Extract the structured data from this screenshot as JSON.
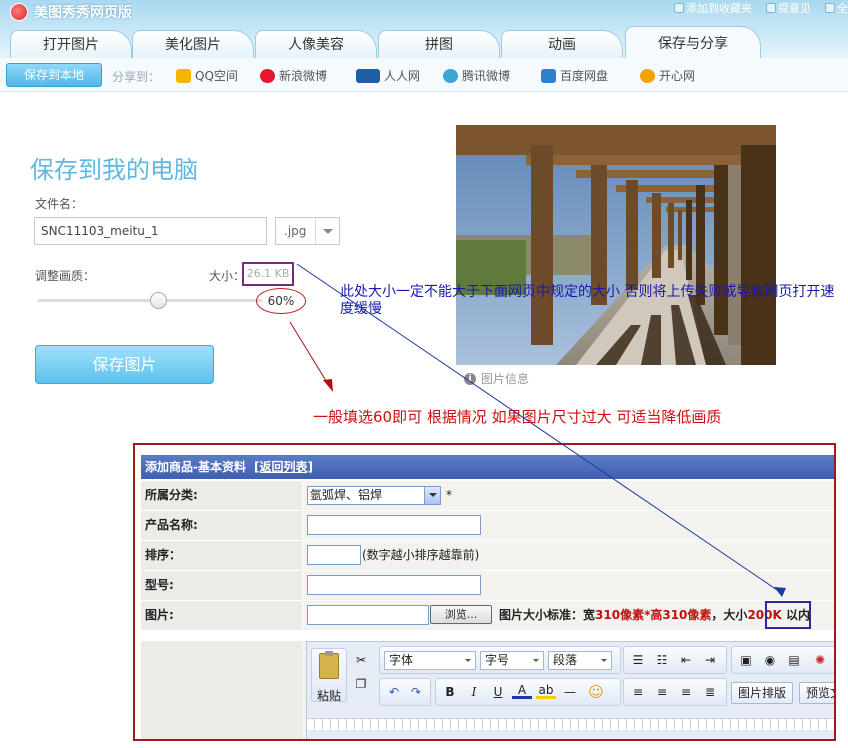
{
  "app": {
    "title": "美图秀秀网页版"
  },
  "top_links": [
    {
      "icon": "star-icon",
      "label": "添加到收藏夹"
    },
    {
      "icon": "feedback-icon",
      "label": "提意见"
    },
    {
      "icon": "more-icon",
      "label": "全"
    }
  ],
  "tabs": [
    {
      "label": "打开图片",
      "active": false
    },
    {
      "label": "美化图片",
      "active": false
    },
    {
      "label": "人像美容",
      "active": false
    },
    {
      "label": "拼图",
      "active": false
    },
    {
      "label": "动画",
      "active": false
    },
    {
      "label": "保存与分享",
      "active": true
    }
  ],
  "subbar": {
    "save_local": "保存到本地",
    "share_to": "分享到：",
    "targets": [
      {
        "label": "QQ空间",
        "icon": "qzone-icon",
        "color": "#f5b400"
      },
      {
        "label": "新浪微博",
        "icon": "weibo-icon",
        "color": "#e6162d"
      },
      {
        "label": "人人网",
        "icon": "renren-icon",
        "color": "#1f5fa8"
      },
      {
        "label": "腾讯微博",
        "icon": "tencent-weibo-icon",
        "color": "#3aa6d8"
      },
      {
        "label": "百度网盘",
        "icon": "baidu-pan-icon",
        "color": "#2e7fd0"
      },
      {
        "label": "开心网",
        "icon": "kaixin-icon",
        "color": "#f2a400"
      }
    ]
  },
  "save_panel": {
    "title": "保存到我的电脑",
    "filename_label": "文件名：",
    "filename": "SNC11103_meitu_1",
    "extension": ".jpg",
    "quality_label": "调整画质：",
    "size_label": "大小：",
    "size_value": "26.1 KB",
    "quality_value": "60%",
    "quality_level": 0.6,
    "save_button": "保存图片"
  },
  "photo": {
    "info_label": "图片信息"
  },
  "annotations": {
    "blue_note": "此处大小一定不能大于下面网页中规定的大小 否则将上传失败或导致网页打开速度缓慢",
    "red_note": "一般填选60即可  根据情况  如果图片尺寸过大  可适当降低画质"
  },
  "form": {
    "header": "添加商品-基本资料",
    "back_link": "[返回列表]",
    "category_label": "所属分类:",
    "category_value": "氩弧焊、铝焊",
    "required_mark": "*",
    "name_label": "产品名称:",
    "order_label": "排序：",
    "order_hint": "(数字越小排序越靠前)",
    "model_label": "型号:",
    "image_label": "图片:",
    "browse_button": "浏览...",
    "image_std_prefix": "图片大小标准：宽",
    "image_std_width": "310像素",
    "image_std_mid": "*高",
    "image_std_height": "310像素",
    "image_std_size_prefix": "，大小",
    "image_std_size": "200K",
    "image_std_suffix": "以内",
    "editor": {
      "paste": "粘贴",
      "font": "字体",
      "font_size": "字号",
      "paragraph": "段落",
      "image_layout": "图片排版",
      "preview": "预览文"
    }
  }
}
